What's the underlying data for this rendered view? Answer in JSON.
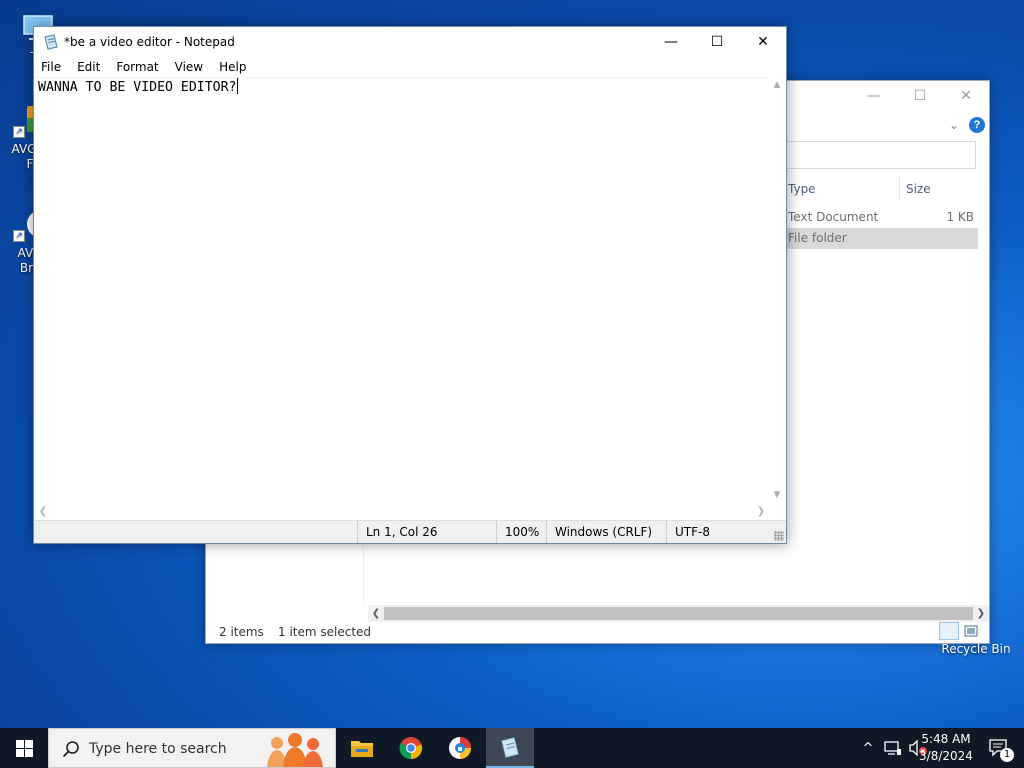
{
  "desktop": {
    "icons": [
      {
        "label": "Th"
      },
      {
        "label_line1": "AVG A",
        "label_line2": "F"
      },
      {
        "label_line1": "AVG",
        "label_line2": "Bro"
      }
    ],
    "recycle_bin": "Recycle Bin"
  },
  "explorer": {
    "columns": {
      "type": "Type",
      "size": "Size"
    },
    "rows": [
      {
        "type": "Text Document",
        "size": "1 KB",
        "selected": false
      },
      {
        "type": "File folder",
        "size": "",
        "selected": true
      }
    ],
    "status": {
      "count": "2 items",
      "selection": "1 item selected"
    }
  },
  "notepad": {
    "title": "*be a video editor - Notepad",
    "menu": [
      "File",
      "Edit",
      "Format",
      "View",
      "Help"
    ],
    "content": "WANNA TO BE VIDEO EDITOR?",
    "status": {
      "position": "Ln 1, Col 26",
      "zoom": "100%",
      "line_ending": "Windows (CRLF)",
      "encoding": "UTF-8"
    }
  },
  "taskbar": {
    "search_placeholder": "Type here to search",
    "apps": [
      "file-explorer",
      "chrome",
      "avg-secure-browser",
      "notepad"
    ],
    "active_app": "notepad",
    "clock": {
      "time": "5:48 AM",
      "date": "3/8/2024"
    },
    "notification_count": "1"
  },
  "colors": {
    "taskbar": "#101a26",
    "selection": "#d9d9d9",
    "accent": "#76b9ed"
  }
}
